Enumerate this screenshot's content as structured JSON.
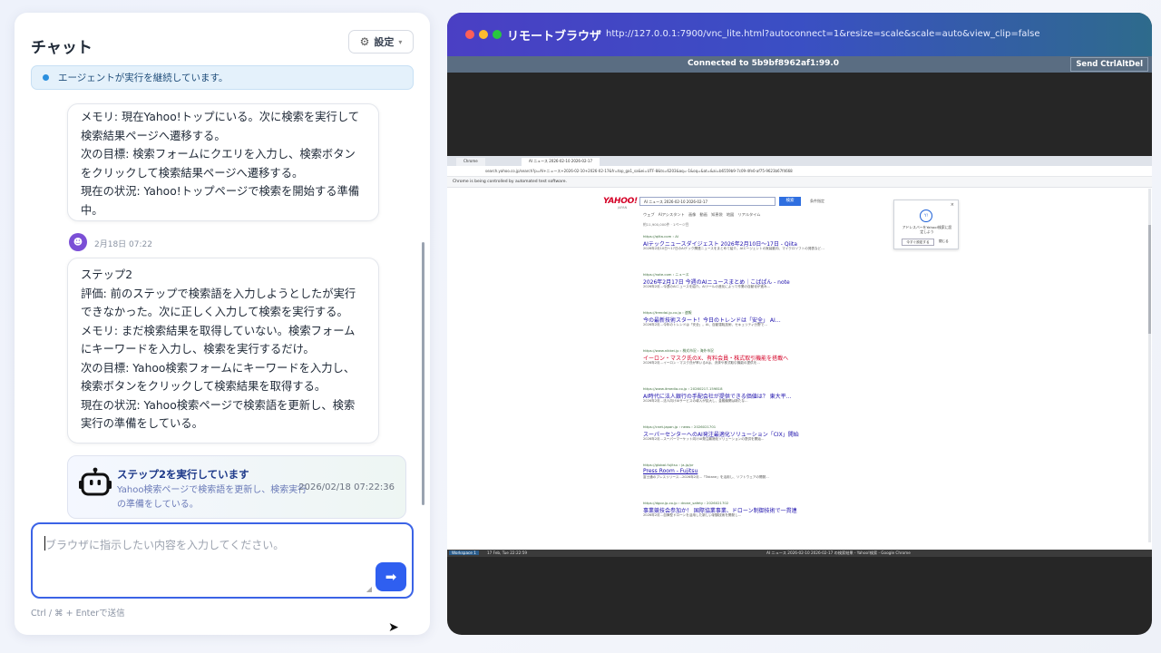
{
  "chat": {
    "title": "チャット",
    "settings_label": "設定",
    "status": "エージェントが実行を継続しています。",
    "message1": [
      "メモリ: 現在Yahoo!トップにいる。次に検索を実行して検索結果ページへ遷移する。",
      "次の目標: 検索フォームにクエリを入力し、検索ボタンをクリックして検索結果ページへ遷移する。",
      "現在の状況: Yahoo!トップページで検索を開始する準備中。"
    ],
    "timestamp": "2月18日 07:22",
    "message2": [
      "ステップ2",
      "評価: 前のステップで検索語を入力しようとしたが実行できなかった。次に正しく入力して検索を実行する。",
      "メモリ: まだ検索結果を取得していない。検索フォームにキーワードを入力し、検索を実行するだけ。",
      "次の目標: Yahoo検索フォームにキーワードを入力し、検索ボタンをクリックして検索結果を取得する。",
      "現在の状況: Yahoo検索ページで検索語を更新し、検索実行の準備をしている。"
    ],
    "exec_card": {
      "title": "ステップ2を実行しています",
      "desc": "Yahoo検索ページで検索語を更新し、検索実行の準備をしている。",
      "time": "2026/02/18 07:22:36"
    },
    "input_placeholder": "ブラウザに指示したい内容を入力してください。",
    "hint": "Ctrl / ⌘ + Enterで送信"
  },
  "remote": {
    "title": "リモートブラウザ",
    "url": "http://127.0.0.1:7900/vnc_lite.html?autoconnect=1&resize=scale&scale=auto&view_clip=false",
    "vnc_status": "Connected to 5b9bf8962af1:99.0",
    "vnc_button": "Send CtrlAltDel",
    "dot_colors": [
      "#ff5f57",
      "#febc2e",
      "#28c840"
    ]
  },
  "browser": {
    "tab1": "Chrome",
    "tab2": "AI ニュース 2026-02-10 2026-02-17",
    "address": "search.yahoo.co.jp/search?p=AI+ニュース+2026-02-10+2026-02-17&fr=top_ga1_sa&ei=UTF-8&ts=6203&aq=-1&oq=&at=&ai=b6559b9-7c09-4fe0-af75-9623b67f4668",
    "infobar": "Chrome is being controlled by automated test software.",
    "yahoo_logo": "YAHOO!",
    "yahoo_sub": "JAPAN",
    "search_query": "AI ニュース 2026-02-10 2026-02-17",
    "search_button": "検索",
    "extra": "条件指定",
    "tabs": "ウェブ　AIアシスタント　画像　動画　知恵袋　地図　リアルタイム",
    "count": "約11,900,000件 · 1ページ目",
    "results": [
      {
        "url": "https://qiita.com › AI",
        "title": "AIテックニュースダイジェスト 2026年2月10日〜17日 - Qiita",
        "snip": "2026年2月10日〜17日のAIテック関連ニュースをまとめて紹介。AIエージェントの実装動向、マイクロソフトの発表など…",
        "red": false
      },
      {
        "url": "https://note.com › ニュース",
        "title": "2026年2月17日 今週のAIニュースまとめ｜こばぱん - note",
        "snip": "2026年2月…今週のAIニュースを紹介。AIツールの進化によって作業の自動化が進み…",
        "red": false
      },
      {
        "url": "https://trendai.jp.co.jp › 速報",
        "title": "今の最新技術スタート！今日のトレンドは「安全」 AI…",
        "snip": "2026年2月…今年のトレンドは「安全」。AI、自動運転技術、セキュリティ分野で…",
        "red": false
      },
      {
        "url": "https://www.nikkei.jp › 株式市況 › 海外市況",
        "title": "イーロン・マスク氏のX、有料会員・株式取引機能を搭載へ",
        "snip": "2026年2月…イーロン・マスク氏が率いるXは、決済や株式取引機能の提供を…",
        "red": true
      },
      {
        "url": "https://www.itmedia.co.jp › 20260217-159818",
        "title": "AI時代に法人銀行の手配会社が提供できる価値は？ 東大平…",
        "snip": "2026年2月…法人向けAIサービスの導入が拡大し、金融機関は新たな…",
        "red": false
      },
      {
        "url": "https://cnet.japan.jp › news › 2026021701",
        "title": "スーパーセンターへのAI発注最適化ソリューション「CIX」開始",
        "snip": "2026年2月…スーパーマーケット向けAI発注最適化ソリューションの提供を開始…",
        "red": false
      },
      {
        "url": "https://global.fujitsu › ja-jp/pr",
        "title": "Press Room - Fujitsu",
        "snip": "富士通のプレスリリース…2026年2月…「Takane」を活用し、ソフトウェアの開発…",
        "red": false
      },
      {
        "url": "https://dgov.jp.co.jp › drone_safety › 2026021702",
        "title": "事業競技会参加か！ 国際協業事業、ドローン制御技術で一貫連",
        "snip": "2026年2月…自律型ドローンを活用した新しい制御技術を開発し…",
        "red": false
      }
    ],
    "popup_text": "アドレスバーをYahoo!検索に設定しよう",
    "popup_btn": "今すぐ設定する",
    "popup_btn2": "閉じる",
    "taskbar_ws": "Workspace 1",
    "taskbar_time": "17 Feb, Tue 22:22:59",
    "taskbar_window": "AI ニュース 2026-02-10 2026-02-17 の検索結果 - Yahoo!検索 - Google Chrome"
  }
}
